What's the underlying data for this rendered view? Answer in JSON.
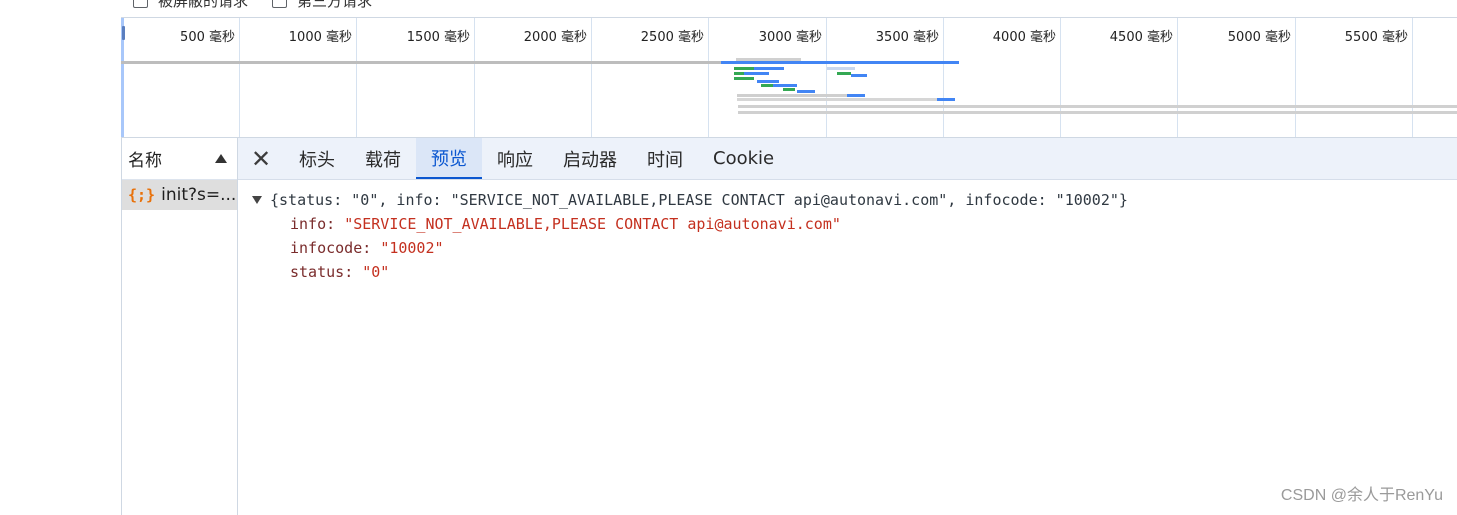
{
  "filters": [
    {
      "label": "被屏蔽的请求"
    },
    {
      "label": "第三方请求"
    }
  ],
  "timeline": {
    "ticks": [
      "500 毫秒",
      "1000 毫秒",
      "1500 毫秒",
      "2000 毫秒",
      "2500 毫秒",
      "3000 毫秒",
      "3500 毫秒",
      "4000 毫秒",
      "4500 毫秒",
      "5000 毫秒",
      "5500 毫秒"
    ]
  },
  "name_column": {
    "header": "名称",
    "requests": [
      {
        "icon": "{;}",
        "name": "init?s=..."
      }
    ]
  },
  "tabs": [
    "标头",
    "载荷",
    "预览",
    "响应",
    "启动器",
    "时间",
    "Cookie"
  ],
  "active_tab": "预览",
  "preview": {
    "summary": "{status: \"0\", info: \"SERVICE_NOT_AVAILABLE,PLEASE CONTACT api@autonavi.com\", infocode: \"10002\"}",
    "props": [
      {
        "key": "info",
        "value": "\"SERVICE_NOT_AVAILABLE,PLEASE CONTACT api@autonavi.com\""
      },
      {
        "key": "infocode",
        "value": "\"10002\""
      },
      {
        "key": "status",
        "value": "\"0\""
      }
    ]
  },
  "watermark": "CSDN @余人于RenYu",
  "colors": {
    "accent": "#0b57d0",
    "tab_bg": "#edf2fa",
    "string_value": "#c4301f",
    "bar_blue": "#4285f4",
    "bar_green": "#34a853",
    "bar_gray": "#bdbdbd"
  }
}
